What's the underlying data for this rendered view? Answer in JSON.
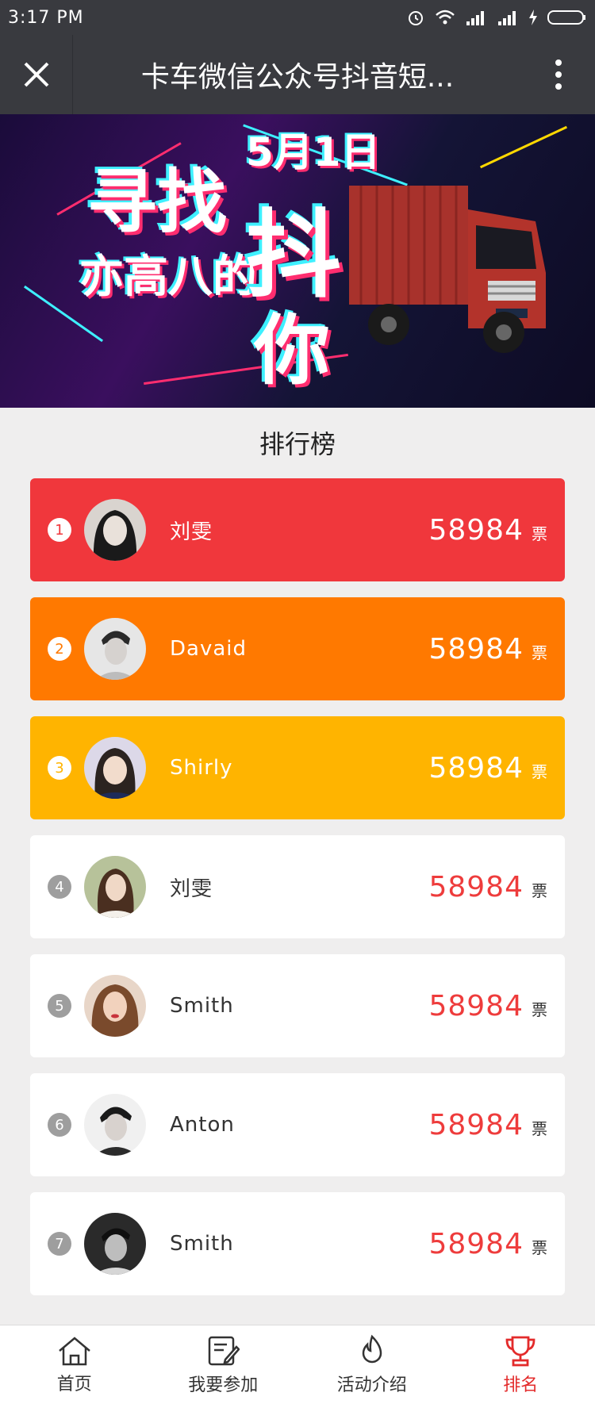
{
  "status": {
    "time": "3:17  PM"
  },
  "nav": {
    "title": "卡车微信公众号抖音短..."
  },
  "banner": {
    "date_text": "5月1日",
    "line1": "寻找",
    "line2": "抖",
    "line3": "你",
    "line4": "亦高八的",
    "accent_color": "#ff2d6f"
  },
  "section_title": "排行榜",
  "ranking": [
    {
      "rank": "1",
      "name": "刘雯",
      "votes": "58984",
      "unit": "票",
      "color": "#f0373c"
    },
    {
      "rank": "2",
      "name": "Davaid",
      "votes": "58984",
      "unit": "票",
      "color": "#ff7900"
    },
    {
      "rank": "3",
      "name": "Shirly",
      "votes": "58984",
      "unit": "票",
      "color": "#ffb400"
    },
    {
      "rank": "4",
      "name": "刘雯",
      "votes": "58984",
      "unit": "票"
    },
    {
      "rank": "5",
      "name": "Smith",
      "votes": "58984",
      "unit": "票"
    },
    {
      "rank": "6",
      "name": "Anton",
      "votes": "58984",
      "unit": "票"
    },
    {
      "rank": "7",
      "name": "Smith",
      "votes": "58984",
      "unit": "票"
    }
  ],
  "tabs": [
    {
      "label": "首页",
      "icon": "home-icon"
    },
    {
      "label": "我要参加",
      "icon": "edit-icon"
    },
    {
      "label": "活动介绍",
      "icon": "flame-icon"
    },
    {
      "label": "排名",
      "icon": "trophy-icon",
      "active": true
    }
  ]
}
